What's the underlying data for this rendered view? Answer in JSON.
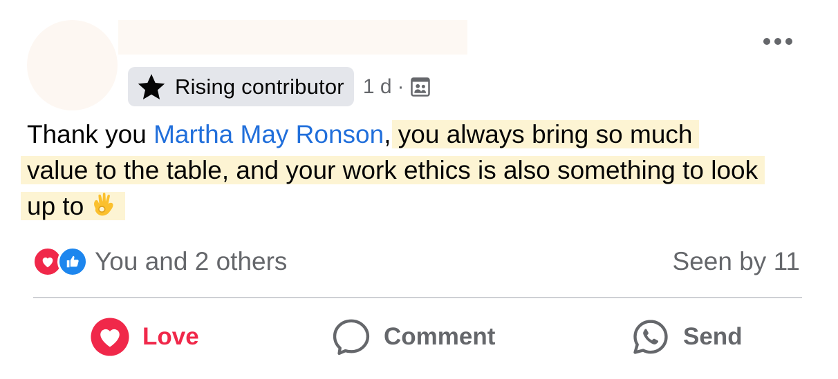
{
  "post": {
    "badge": {
      "icon": "star-icon",
      "label": "Rising contributor"
    },
    "time": "1 d",
    "separator": "·",
    "audience_icon": "group-privacy-icon",
    "more_icon": "more-horizontal-icon",
    "text": {
      "prefix": "Thank you ",
      "mention": "Martha May Ronson",
      "comma": ",",
      "highlighted": "you always bring so much value to the table, and your work ethics is also something to look up to",
      "emoji": "ok-hand-emoji"
    }
  },
  "reactions": {
    "icons": [
      "love-reaction-icon",
      "like-reaction-icon"
    ],
    "summary": "You and 2 others",
    "seen": "Seen by 11"
  },
  "actions": {
    "love": "Love",
    "comment": "Comment",
    "send": "Send"
  },
  "colors": {
    "love": "#f0284a",
    "like": "#1d86ee",
    "mention": "#216fdb",
    "highlight": "#fdf4d3",
    "muted": "#65676b"
  }
}
